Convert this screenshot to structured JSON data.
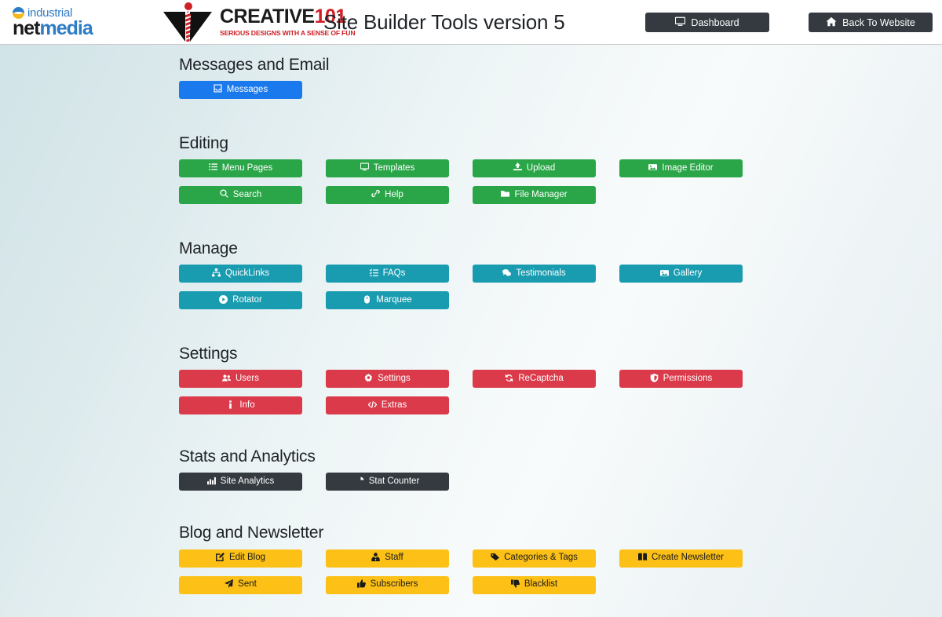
{
  "header": {
    "brand_left": {
      "line1": "industrial",
      "line2_a": "net",
      "line2_b": "media",
      "globe_icon": "globe-icon"
    },
    "brand_center": {
      "title_a": "CREATIVE",
      "title_b": "101",
      "tagline": "SERIOUS DESIGNS WITH A SENSE OF FUN",
      "tux_icon": "tuxedo-icon"
    },
    "app_title": "Site Builder Tools version 5",
    "buttons": [
      {
        "label": "Dashboard",
        "icon": "desktop-icon"
      },
      {
        "label": "Back To Website",
        "icon": "home-icon"
      }
    ]
  },
  "colors": {
    "primary": "#1a7aed",
    "success": "#2aa648",
    "info": "#1a9cb0",
    "danger": "#db3a4a",
    "dark": "#343a40",
    "warning": "#fcc016",
    "header_bg": "#ffffff",
    "page_bg": "#e9f1f3",
    "text_dark": "#1f2328",
    "text_light": "#ffffff"
  },
  "sections": [
    {
      "title": "Messages and Email",
      "color": "#1a7aed",
      "text_color": "#ffffff",
      "buttons": [
        {
          "label": "Messages",
          "icon": "inbox-icon"
        }
      ]
    },
    {
      "title": "Editing",
      "color": "#2aa648",
      "text_color": "#ffffff",
      "buttons": [
        {
          "label": "Menu Pages",
          "icon": "list-icon"
        },
        {
          "label": "Templates",
          "icon": "desktop-icon"
        },
        {
          "label": "Upload",
          "icon": "upload-icon"
        },
        {
          "label": "Image Editor",
          "icon": "image-icon"
        },
        {
          "label": "Search",
          "icon": "search-icon"
        },
        {
          "label": "Help",
          "icon": "link-icon"
        },
        {
          "label": "File Manager",
          "icon": "folder-icon"
        }
      ]
    },
    {
      "title": "Manage",
      "color": "#1a9cb0",
      "text_color": "#ffffff",
      "buttons": [
        {
          "label": "QuickLinks",
          "icon": "sitemap-icon"
        },
        {
          "label": "FAQs",
          "icon": "tasks-icon"
        },
        {
          "label": "Testimonials",
          "icon": "comments-icon"
        },
        {
          "label": "Gallery",
          "icon": "images-icon"
        },
        {
          "label": "Rotator",
          "icon": "play-circle-icon"
        },
        {
          "label": "Marquee",
          "icon": "mouse-icon"
        }
      ]
    },
    {
      "title": "Settings",
      "color": "#db3a4a",
      "text_color": "#ffffff",
      "buttons": [
        {
          "label": "Users",
          "icon": "users-icon"
        },
        {
          "label": "Settings",
          "icon": "gear-icon"
        },
        {
          "label": "ReCaptcha",
          "icon": "refresh-icon"
        },
        {
          "label": "Permissions",
          "icon": "shield-icon"
        },
        {
          "label": "Info",
          "icon": "info-icon"
        },
        {
          "label": "Extras",
          "icon": "code-icon"
        }
      ]
    },
    {
      "title": "Stats and Analytics",
      "color": "#343a40",
      "text_color": "#ffffff",
      "buttons": [
        {
          "label": "Site Analytics",
          "icon": "chart-bar-icon"
        },
        {
          "label": "Stat Counter",
          "icon": "pie-chart-icon"
        }
      ]
    },
    {
      "title": "Blog and Newsletter",
      "color": "#fcc016",
      "text_color": "#1b1b1b",
      "buttons": [
        {
          "label": "Edit Blog",
          "icon": "edit-icon"
        },
        {
          "label": "Staff",
          "icon": "user-tie-icon"
        },
        {
          "label": "Categories & Tags",
          "icon": "tag-icon"
        },
        {
          "label": "Create Newsletter",
          "icon": "book-icon"
        },
        {
          "label": "Sent",
          "icon": "paper-plane-icon"
        },
        {
          "label": "Subscribers",
          "icon": "thumbs-up-icon"
        },
        {
          "label": "Blacklist",
          "icon": "thumbs-down-icon"
        }
      ]
    }
  ]
}
